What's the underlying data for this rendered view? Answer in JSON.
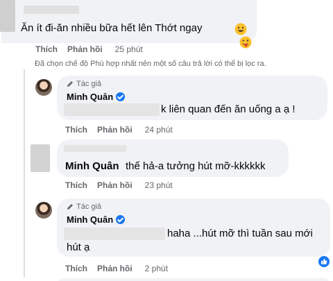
{
  "comments": [
    {
      "text": "Ăn ít đi-ăn nhiều bữa hết lên Thớt ngay",
      "actions": {
        "like": "Thích",
        "reply": "Phản hồi",
        "time": "25 phút"
      }
    },
    {
      "author_badge": "Tác giả",
      "author": "Minh Quân",
      "text": "k liên quan đến ăn uống a ạ !",
      "actions": {
        "like": "Thích",
        "reply": "Phản hồi",
        "time": "24 phút"
      }
    },
    {
      "mention": "Minh Quân",
      "text": "thế hả-a tưởng hút mỡ-kkkkkk",
      "actions": {
        "like": "Thích",
        "reply": "Phản hồi",
        "time": "23 phút"
      }
    },
    {
      "author_badge": "Tác giả",
      "author": "Minh Quân",
      "text_line1": "haha ...hút mỡ thì tuần sau mới",
      "text_line2": "hút ạ",
      "actions": {
        "like": "Thích",
        "reply": "Phản hồi",
        "time": "2 phút"
      }
    }
  ],
  "filter_notice": "Đã chọn chế độ Phù hợp nhất nên một số câu trả lời có thể bị lọc ra.",
  "icons": {
    "emoji_1": "grinning-face-icon",
    "emoji_2": "winking-tongue-face-icon",
    "verified": "verified-badge-icon",
    "author": "pencil-icon",
    "like_reaction": "thumbs-up-icon"
  },
  "colors": {
    "bubble": "#f0f2f5",
    "meta": "#65676b",
    "verified": "#1877f2"
  }
}
